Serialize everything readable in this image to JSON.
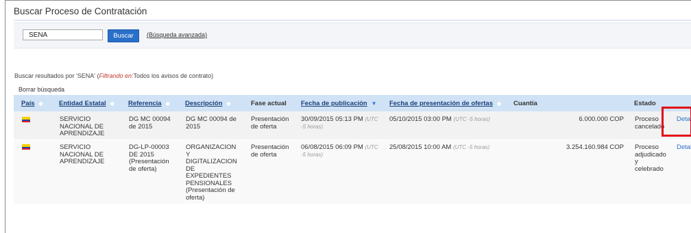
{
  "page": {
    "title": "Buscar Proceso de Contratación"
  },
  "search": {
    "value": "SENA",
    "button_label": "Buscar",
    "advanced_link": "(Búsqueda avanzada)"
  },
  "results": {
    "prefix": "Buscar resultados por 'SENA' (",
    "filter_label": "Filtrando en:",
    "filter_value": "Todos los avisos de contrato)",
    "clear_label": "Borrar búsqueda"
  },
  "table": {
    "headers": {
      "pais": "País",
      "entidad": "Entidad Estatal",
      "referencia": "Referencia",
      "descripcion": "Descripción",
      "fase": "Fase actual",
      "fecha_pub": "Fecha de publicación",
      "fecha_pres": "Fecha de presentación de ofertas",
      "cuantia": "Cuantía",
      "estado": "Estado"
    },
    "rows": [
      {
        "pais": "colombia-flag-icon",
        "entidad": [
          "SERVICIO",
          "NACIONAL DE",
          "APRENDIZAJE"
        ],
        "referencia": [
          "DG MC 00094",
          "de 2015"
        ],
        "descripcion": [
          "DG MC 00094 de",
          "2015"
        ],
        "fase": [
          "Presentación",
          "de oferta"
        ],
        "fecha_pub": "30/09/2015 05:13 PM",
        "fecha_pub_utc1": "(UTC",
        "fecha_pub_utc2": "-5 horas)",
        "fecha_pres": "05/10/2015 03:00 PM",
        "fecha_pres_utc": "(UTC -5 horas)",
        "cuantia": "6.000.000 COP",
        "estado": [
          "Proceso",
          "cancelado"
        ],
        "detalle": "Detal"
      },
      {
        "pais": "colombia-flag-icon",
        "entidad": [
          "SERVICIO",
          "NACIONAL DE",
          "APRENDIZAJE"
        ],
        "referencia": [
          "DG-LP-00003",
          "DE 2015",
          "(Presentación",
          "de oferta)"
        ],
        "descripcion": [
          "ORGANIZACION",
          "Y",
          "DIGITALIZACION",
          "DE",
          "EXPEDIENTES",
          "PENSIONALES",
          "(Presentación de",
          "oferta)"
        ],
        "fase": [
          "Presentación",
          "de oferta"
        ],
        "fecha_pub": "06/08/2015 06:09 PM",
        "fecha_pub_utc1": "(UTC",
        "fecha_pub_utc2": "-5 horas)",
        "fecha_pres": "25/08/2015 10:00 AM",
        "fecha_pres_utc": "(UTC -5 horas)",
        "cuantia": "3.254.160.984 COP",
        "estado": [
          "Proceso",
          "adjudicado",
          "y",
          "celebrado"
        ],
        "detalle": "Detal"
      }
    ]
  },
  "colors": {
    "accent": "#2a6fc9",
    "header_bg": "#d0e2f5",
    "highlight": "#e30613"
  }
}
